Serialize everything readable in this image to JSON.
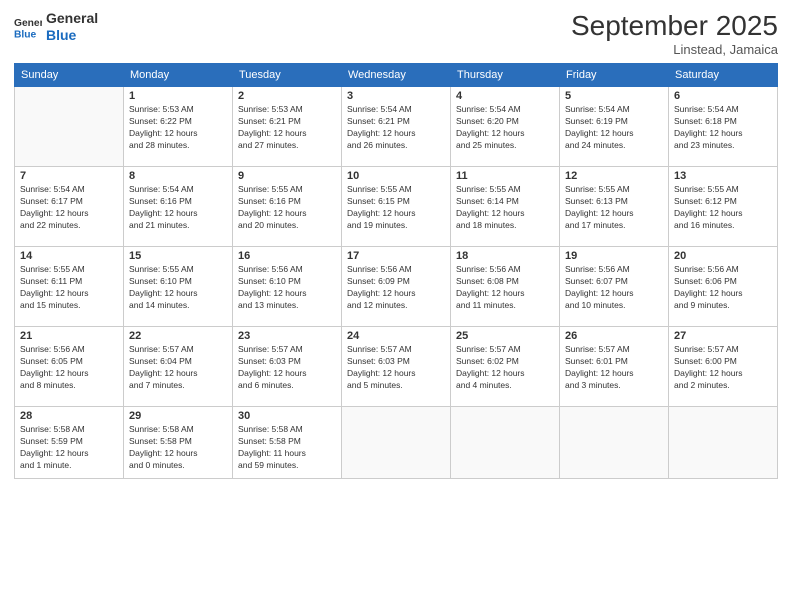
{
  "header": {
    "logo_line1": "General",
    "logo_line2": "Blue",
    "month": "September 2025",
    "location": "Linstead, Jamaica"
  },
  "weekdays": [
    "Sunday",
    "Monday",
    "Tuesday",
    "Wednesday",
    "Thursday",
    "Friday",
    "Saturday"
  ],
  "weeks": [
    [
      {
        "day": "",
        "info": ""
      },
      {
        "day": "1",
        "info": "Sunrise: 5:53 AM\nSunset: 6:22 PM\nDaylight: 12 hours\nand 28 minutes."
      },
      {
        "day": "2",
        "info": "Sunrise: 5:53 AM\nSunset: 6:21 PM\nDaylight: 12 hours\nand 27 minutes."
      },
      {
        "day": "3",
        "info": "Sunrise: 5:54 AM\nSunset: 6:21 PM\nDaylight: 12 hours\nand 26 minutes."
      },
      {
        "day": "4",
        "info": "Sunrise: 5:54 AM\nSunset: 6:20 PM\nDaylight: 12 hours\nand 25 minutes."
      },
      {
        "day": "5",
        "info": "Sunrise: 5:54 AM\nSunset: 6:19 PM\nDaylight: 12 hours\nand 24 minutes."
      },
      {
        "day": "6",
        "info": "Sunrise: 5:54 AM\nSunset: 6:18 PM\nDaylight: 12 hours\nand 23 minutes."
      }
    ],
    [
      {
        "day": "7",
        "info": "Sunrise: 5:54 AM\nSunset: 6:17 PM\nDaylight: 12 hours\nand 22 minutes."
      },
      {
        "day": "8",
        "info": "Sunrise: 5:54 AM\nSunset: 6:16 PM\nDaylight: 12 hours\nand 21 minutes."
      },
      {
        "day": "9",
        "info": "Sunrise: 5:55 AM\nSunset: 6:16 PM\nDaylight: 12 hours\nand 20 minutes."
      },
      {
        "day": "10",
        "info": "Sunrise: 5:55 AM\nSunset: 6:15 PM\nDaylight: 12 hours\nand 19 minutes."
      },
      {
        "day": "11",
        "info": "Sunrise: 5:55 AM\nSunset: 6:14 PM\nDaylight: 12 hours\nand 18 minutes."
      },
      {
        "day": "12",
        "info": "Sunrise: 5:55 AM\nSunset: 6:13 PM\nDaylight: 12 hours\nand 17 minutes."
      },
      {
        "day": "13",
        "info": "Sunrise: 5:55 AM\nSunset: 6:12 PM\nDaylight: 12 hours\nand 16 minutes."
      }
    ],
    [
      {
        "day": "14",
        "info": "Sunrise: 5:55 AM\nSunset: 6:11 PM\nDaylight: 12 hours\nand 15 minutes."
      },
      {
        "day": "15",
        "info": "Sunrise: 5:55 AM\nSunset: 6:10 PM\nDaylight: 12 hours\nand 14 minutes."
      },
      {
        "day": "16",
        "info": "Sunrise: 5:56 AM\nSunset: 6:10 PM\nDaylight: 12 hours\nand 13 minutes."
      },
      {
        "day": "17",
        "info": "Sunrise: 5:56 AM\nSunset: 6:09 PM\nDaylight: 12 hours\nand 12 minutes."
      },
      {
        "day": "18",
        "info": "Sunrise: 5:56 AM\nSunset: 6:08 PM\nDaylight: 12 hours\nand 11 minutes."
      },
      {
        "day": "19",
        "info": "Sunrise: 5:56 AM\nSunset: 6:07 PM\nDaylight: 12 hours\nand 10 minutes."
      },
      {
        "day": "20",
        "info": "Sunrise: 5:56 AM\nSunset: 6:06 PM\nDaylight: 12 hours\nand 9 minutes."
      }
    ],
    [
      {
        "day": "21",
        "info": "Sunrise: 5:56 AM\nSunset: 6:05 PM\nDaylight: 12 hours\nand 8 minutes."
      },
      {
        "day": "22",
        "info": "Sunrise: 5:57 AM\nSunset: 6:04 PM\nDaylight: 12 hours\nand 7 minutes."
      },
      {
        "day": "23",
        "info": "Sunrise: 5:57 AM\nSunset: 6:03 PM\nDaylight: 12 hours\nand 6 minutes."
      },
      {
        "day": "24",
        "info": "Sunrise: 5:57 AM\nSunset: 6:03 PM\nDaylight: 12 hours\nand 5 minutes."
      },
      {
        "day": "25",
        "info": "Sunrise: 5:57 AM\nSunset: 6:02 PM\nDaylight: 12 hours\nand 4 minutes."
      },
      {
        "day": "26",
        "info": "Sunrise: 5:57 AM\nSunset: 6:01 PM\nDaylight: 12 hours\nand 3 minutes."
      },
      {
        "day": "27",
        "info": "Sunrise: 5:57 AM\nSunset: 6:00 PM\nDaylight: 12 hours\nand 2 minutes."
      }
    ],
    [
      {
        "day": "28",
        "info": "Sunrise: 5:58 AM\nSunset: 5:59 PM\nDaylight: 12 hours\nand 1 minute."
      },
      {
        "day": "29",
        "info": "Sunrise: 5:58 AM\nSunset: 5:58 PM\nDaylight: 12 hours\nand 0 minutes."
      },
      {
        "day": "30",
        "info": "Sunrise: 5:58 AM\nSunset: 5:58 PM\nDaylight: 11 hours\nand 59 minutes."
      },
      {
        "day": "",
        "info": ""
      },
      {
        "day": "",
        "info": ""
      },
      {
        "day": "",
        "info": ""
      },
      {
        "day": "",
        "info": ""
      }
    ]
  ]
}
